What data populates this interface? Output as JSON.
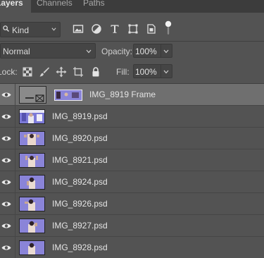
{
  "tabs": [
    {
      "label": "Layers",
      "active": true
    },
    {
      "label": "Channels",
      "active": false
    },
    {
      "label": "Paths",
      "active": false
    }
  ],
  "filter": {
    "kind_label": "Kind",
    "icons": [
      "image-filter-icon",
      "adjustment-filter-icon",
      "type-filter-icon",
      "shape-filter-icon",
      "smart-object-filter-icon",
      "filter-toggle-icon"
    ]
  },
  "blend": {
    "mode": "Normal",
    "opacity_label": "Opacity:",
    "opacity_value": "100%"
  },
  "lock": {
    "label": "Lock:",
    "icons": [
      "lock-transparent-icon",
      "lock-image-icon",
      "lock-position-icon",
      "lock-artboard-icon",
      "lock-all-icon"
    ],
    "fill_label": "Fill:",
    "fill_value": "100%"
  },
  "layers": [
    {
      "name": "IMG_8919 Frame",
      "selected": true,
      "type": "frame"
    },
    {
      "name": "IMG_8919.psd",
      "selected": false,
      "type": "image"
    },
    {
      "name": "IMG_8920.psd",
      "selected": false,
      "type": "image"
    },
    {
      "name": "IMG_8921.psd",
      "selected": false,
      "type": "image"
    },
    {
      "name": "IMG_8924.psd",
      "selected": false,
      "type": "image"
    },
    {
      "name": "IMG_8926.psd",
      "selected": false,
      "type": "image"
    },
    {
      "name": "IMG_8927.psd",
      "selected": false,
      "type": "image"
    },
    {
      "name": "IMG_8928.psd",
      "selected": false,
      "type": "image"
    }
  ],
  "colors": {
    "panel_bg": "#535353",
    "selected_row": "#6f6f6f",
    "thumb_bg": "#8a84d8"
  }
}
